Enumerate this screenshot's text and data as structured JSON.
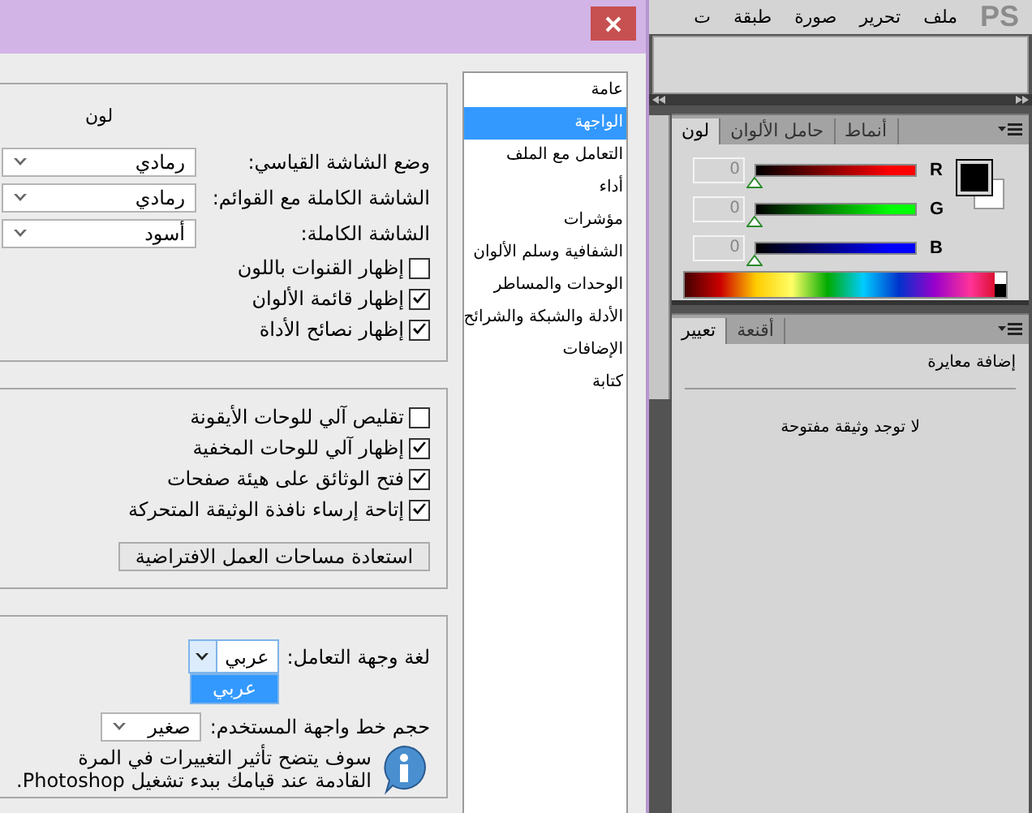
{
  "app": {
    "logo": "PS",
    "menu": [
      "ملف",
      "تحرير",
      "صورة",
      "طبقة",
      "ت"
    ]
  },
  "color_panel": {
    "tabs": [
      {
        "label": "أنماط",
        "selected": false
      },
      {
        "label": "حامل الألوان",
        "selected": false
      },
      {
        "label": "لون",
        "selected": true
      }
    ],
    "channels": [
      {
        "label": "R",
        "value": "0",
        "level": 0,
        "color": "#ff0000"
      },
      {
        "label": "G",
        "value": "0",
        "level": 0,
        "color": "#00ff00"
      },
      {
        "label": "B",
        "value": "0",
        "level": 0,
        "color": "#0000ff"
      }
    ]
  },
  "adjustments_panel": {
    "tabs": [
      {
        "label": "أقنعة",
        "selected": false
      },
      {
        "label": "تعيير",
        "selected": true
      }
    ],
    "add_label": "إضافة معايرة",
    "empty_message": "لا توجد وثيقة مفتوحة"
  },
  "dialog": {
    "categories": [
      {
        "label": "عامة",
        "selected": false
      },
      {
        "label": "الواجهة",
        "selected": true
      },
      {
        "label": "التعامل مع الملف",
        "selected": false
      },
      {
        "label": "أداء",
        "selected": false
      },
      {
        "label": "مؤشرات",
        "selected": false
      },
      {
        "label": "الشفافية وسلم الألوان",
        "selected": false
      },
      {
        "label": "الوحدات والمساطر",
        "selected": false
      },
      {
        "label": "الأدلة والشبكة والشرائح",
        "selected": false
      },
      {
        "label": "الإضافات",
        "selected": false
      },
      {
        "label": "كتابة",
        "selected": false
      }
    ],
    "appearance": {
      "column_header": "لون",
      "selects": [
        {
          "label": "وضع الشاشة القياسي:",
          "value": "رمادي"
        },
        {
          "label": "الشاشة الكاملة مع القوائم:",
          "value": "رمادي"
        },
        {
          "label": "الشاشة الكاملة:",
          "value": "أسود"
        }
      ],
      "checkboxes": [
        {
          "label": "إظهار القنوات باللون",
          "checked": false
        },
        {
          "label": "إظهار قائمة الألوان",
          "checked": true
        },
        {
          "label": "إظهار نصائح الأداة",
          "checked": true
        }
      ]
    },
    "panels": {
      "checkboxes": [
        {
          "label": "تقليص آلي للوحات الأيقونة",
          "checked": false
        },
        {
          "label": "إظهار آلي للوحات المخفية",
          "checked": true
        },
        {
          "label": "فتح الوثائق على هيئة صفحات",
          "checked": true
        },
        {
          "label": "إتاحة إرساء نافذة الوثيقة المتحركة",
          "checked": true
        }
      ],
      "restore_button": "استعادة مساحات العمل الافتراضية"
    },
    "text": {
      "language": {
        "label": "لغة وجهة التعامل:",
        "value": "عربي",
        "expanded": true,
        "options": [
          {
            "label": "عربي",
            "selected": true
          }
        ]
      },
      "font_size": {
        "label": "حجم خط واجهة المستخدم:",
        "value": "صغير"
      },
      "note_lines": [
        "سوف يتضح تأثير التغييرات في المرة",
        "القادمة عند قيامك ببدء تشغيل Photoshop."
      ]
    }
  }
}
